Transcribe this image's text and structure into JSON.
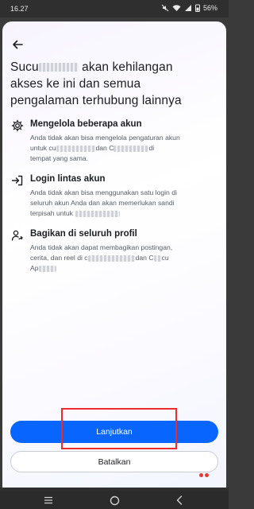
{
  "status_bar": {
    "time": "16.27",
    "battery": "56%"
  },
  "header": {
    "back_icon": "arrow-left-icon"
  },
  "title": {
    "prefix": "Sucu",
    "middle": " akan kehilangan",
    "line2": "akses ke ini dan semua",
    "line3": "pengalaman terhubung lainnya"
  },
  "items": [
    {
      "icon": "gear-icon",
      "heading": "Mengelola beberapa akun",
      "desc_a": "Anda tidak akan bisa mengelola pengaturan akun",
      "desc_b": "untuk cu",
      "desc_c": "dan C",
      "desc_d": "di",
      "desc_e": "tempat yang sama."
    },
    {
      "icon": "login-arrow-icon",
      "heading": "Login lintas akun",
      "desc_a": "Anda tidak akan bisa menggunakan satu login di",
      "desc_b": "seluruh akun Anda dan akan memerlukan sandi",
      "desc_c": "terpisah untuk"
    },
    {
      "icon": "person-share-icon",
      "heading": "Bagikan di seluruh profil",
      "desc_a": "Anda tidak akan dapat membagikan postingan,",
      "desc_b": "cerita, dan reel di c",
      "desc_c": "dan C",
      "desc_d": "cu",
      "desc_e": "Ap"
    }
  ],
  "actions": {
    "continue_label": "Lanjutkan",
    "cancel_label": "Batalkan"
  },
  "colors": {
    "primary": "#0866ff",
    "highlight": "#ee2b2b"
  }
}
